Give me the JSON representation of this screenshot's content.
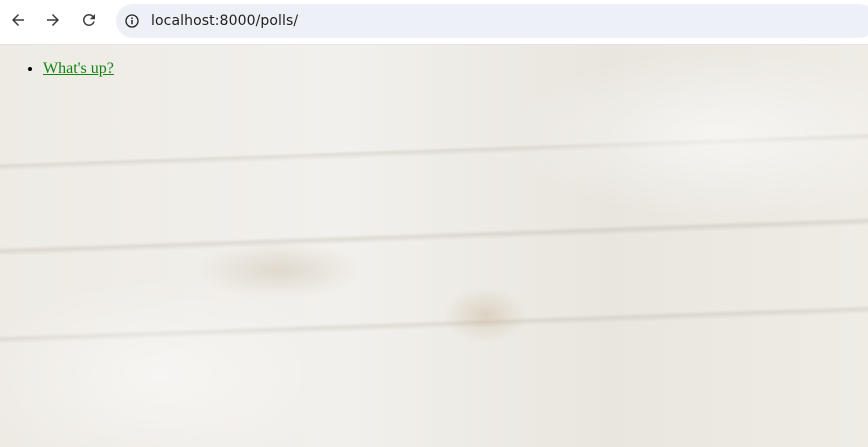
{
  "browser": {
    "url": "localhost:8000/polls/",
    "icons": {
      "back": "arrow-left-icon",
      "forward": "arrow-right-icon",
      "reload": "reload-icon",
      "site_info": "info-icon"
    }
  },
  "polls": {
    "items": [
      {
        "text": "What's up?"
      }
    ],
    "link_color": "#118311"
  }
}
